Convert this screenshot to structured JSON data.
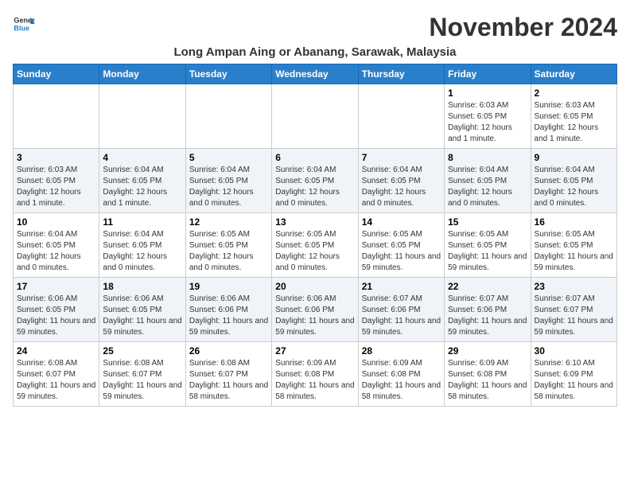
{
  "header": {
    "logo_general": "General",
    "logo_blue": "Blue",
    "month_title": "November 2024",
    "location": "Long Ampan Aing or Abanang, Sarawak, Malaysia"
  },
  "weekdays": [
    "Sunday",
    "Monday",
    "Tuesday",
    "Wednesday",
    "Thursday",
    "Friday",
    "Saturday"
  ],
  "weeks": [
    [
      {
        "day": "",
        "info": ""
      },
      {
        "day": "",
        "info": ""
      },
      {
        "day": "",
        "info": ""
      },
      {
        "day": "",
        "info": ""
      },
      {
        "day": "",
        "info": ""
      },
      {
        "day": "1",
        "info": "Sunrise: 6:03 AM\nSunset: 6:05 PM\nDaylight: 12 hours and 1 minute."
      },
      {
        "day": "2",
        "info": "Sunrise: 6:03 AM\nSunset: 6:05 PM\nDaylight: 12 hours and 1 minute."
      }
    ],
    [
      {
        "day": "3",
        "info": "Sunrise: 6:03 AM\nSunset: 6:05 PM\nDaylight: 12 hours and 1 minute."
      },
      {
        "day": "4",
        "info": "Sunrise: 6:04 AM\nSunset: 6:05 PM\nDaylight: 12 hours and 1 minute."
      },
      {
        "day": "5",
        "info": "Sunrise: 6:04 AM\nSunset: 6:05 PM\nDaylight: 12 hours and 0 minutes."
      },
      {
        "day": "6",
        "info": "Sunrise: 6:04 AM\nSunset: 6:05 PM\nDaylight: 12 hours and 0 minutes."
      },
      {
        "day": "7",
        "info": "Sunrise: 6:04 AM\nSunset: 6:05 PM\nDaylight: 12 hours and 0 minutes."
      },
      {
        "day": "8",
        "info": "Sunrise: 6:04 AM\nSunset: 6:05 PM\nDaylight: 12 hours and 0 minutes."
      },
      {
        "day": "9",
        "info": "Sunrise: 6:04 AM\nSunset: 6:05 PM\nDaylight: 12 hours and 0 minutes."
      }
    ],
    [
      {
        "day": "10",
        "info": "Sunrise: 6:04 AM\nSunset: 6:05 PM\nDaylight: 12 hours and 0 minutes."
      },
      {
        "day": "11",
        "info": "Sunrise: 6:04 AM\nSunset: 6:05 PM\nDaylight: 12 hours and 0 minutes."
      },
      {
        "day": "12",
        "info": "Sunrise: 6:05 AM\nSunset: 6:05 PM\nDaylight: 12 hours and 0 minutes."
      },
      {
        "day": "13",
        "info": "Sunrise: 6:05 AM\nSunset: 6:05 PM\nDaylight: 12 hours and 0 minutes."
      },
      {
        "day": "14",
        "info": "Sunrise: 6:05 AM\nSunset: 6:05 PM\nDaylight: 11 hours and 59 minutes."
      },
      {
        "day": "15",
        "info": "Sunrise: 6:05 AM\nSunset: 6:05 PM\nDaylight: 11 hours and 59 minutes."
      },
      {
        "day": "16",
        "info": "Sunrise: 6:05 AM\nSunset: 6:05 PM\nDaylight: 11 hours and 59 minutes."
      }
    ],
    [
      {
        "day": "17",
        "info": "Sunrise: 6:06 AM\nSunset: 6:05 PM\nDaylight: 11 hours and 59 minutes."
      },
      {
        "day": "18",
        "info": "Sunrise: 6:06 AM\nSunset: 6:05 PM\nDaylight: 11 hours and 59 minutes."
      },
      {
        "day": "19",
        "info": "Sunrise: 6:06 AM\nSunset: 6:06 PM\nDaylight: 11 hours and 59 minutes."
      },
      {
        "day": "20",
        "info": "Sunrise: 6:06 AM\nSunset: 6:06 PM\nDaylight: 11 hours and 59 minutes."
      },
      {
        "day": "21",
        "info": "Sunrise: 6:07 AM\nSunset: 6:06 PM\nDaylight: 11 hours and 59 minutes."
      },
      {
        "day": "22",
        "info": "Sunrise: 6:07 AM\nSunset: 6:06 PM\nDaylight: 11 hours and 59 minutes."
      },
      {
        "day": "23",
        "info": "Sunrise: 6:07 AM\nSunset: 6:07 PM\nDaylight: 11 hours and 59 minutes."
      }
    ],
    [
      {
        "day": "24",
        "info": "Sunrise: 6:08 AM\nSunset: 6:07 PM\nDaylight: 11 hours and 59 minutes."
      },
      {
        "day": "25",
        "info": "Sunrise: 6:08 AM\nSunset: 6:07 PM\nDaylight: 11 hours and 59 minutes."
      },
      {
        "day": "26",
        "info": "Sunrise: 6:08 AM\nSunset: 6:07 PM\nDaylight: 11 hours and 58 minutes."
      },
      {
        "day": "27",
        "info": "Sunrise: 6:09 AM\nSunset: 6:08 PM\nDaylight: 11 hours and 58 minutes."
      },
      {
        "day": "28",
        "info": "Sunrise: 6:09 AM\nSunset: 6:08 PM\nDaylight: 11 hours and 58 minutes."
      },
      {
        "day": "29",
        "info": "Sunrise: 6:09 AM\nSunset: 6:08 PM\nDaylight: 11 hours and 58 minutes."
      },
      {
        "day": "30",
        "info": "Sunrise: 6:10 AM\nSunset: 6:09 PM\nDaylight: 11 hours and 58 minutes."
      }
    ]
  ]
}
